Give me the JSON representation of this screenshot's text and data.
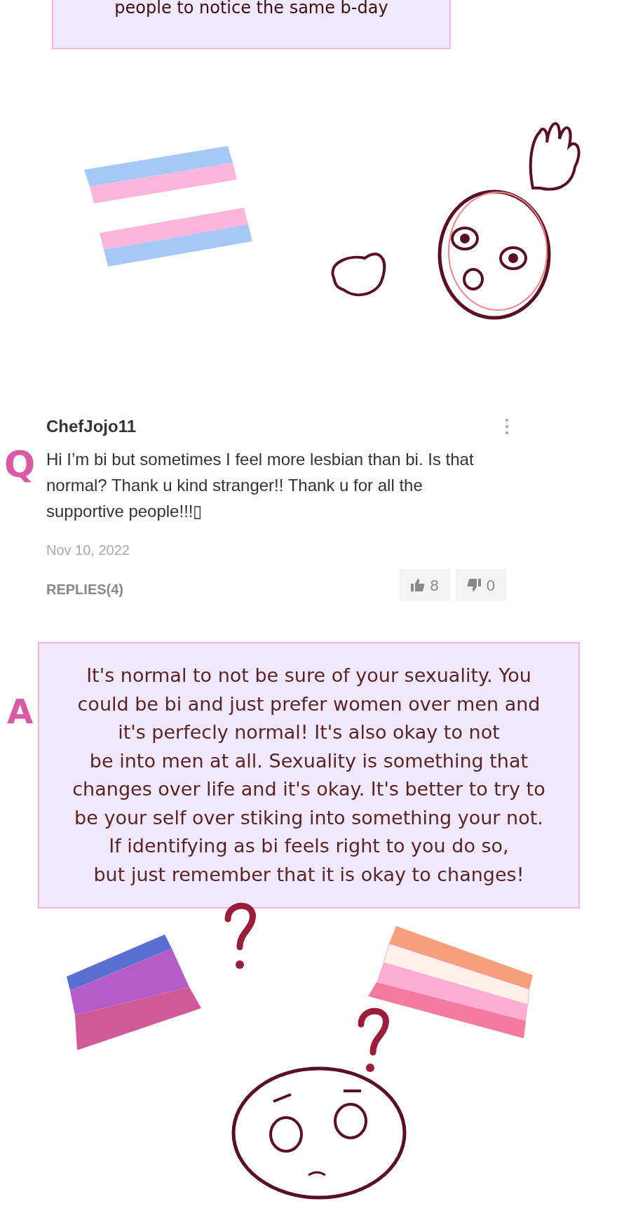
{
  "top_box": {
    "text": "people to notice the same b-day"
  },
  "comment": {
    "marker": "Q",
    "username": "ChefJojo11",
    "body": "Hi I’m bi but sometimes I feel more lesbian than bi. Is that normal? Thank u kind stranger!! Thank u for all the supportive people!!!▯",
    "date": "Nov 10, 2022",
    "replies": "REPLIES(4)",
    "likes": "8",
    "dislikes": "0"
  },
  "answer": {
    "marker": "A",
    "lines": [
      "It's normal to not be sure of your sexuality. You",
      "could be bi and just prefer women over men and",
      "it's perfecly normal! It's also okay to not",
      "be into men at all. Sexuality is something that",
      "changes over life and it's okay. It's better to try to",
      "be your self over stiking into something your not.",
      "If identifying as bi feels right to you do so,",
      "but just remember that it is okay to changes!"
    ]
  }
}
